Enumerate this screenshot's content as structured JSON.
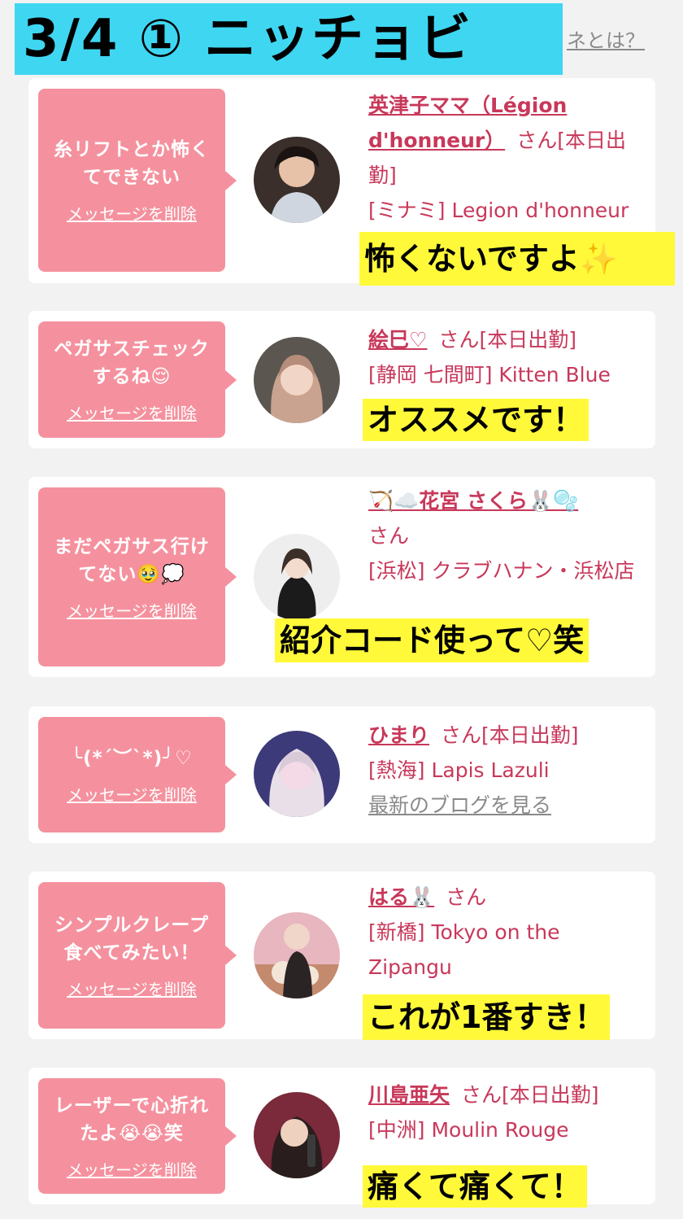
{
  "header": {
    "title": "3/4 ① ニッチョビ",
    "link": "ネとは？"
  },
  "cards": [
    {
      "message": "糸リフトとか怖くてできない",
      "delete": "メッセージを削除",
      "name": "英津子ママ（Légion d'honneur）",
      "san": "さん",
      "status": "[本日出勤]",
      "shop": "[ミナミ] Legion d'honneur",
      "caption": "怖くないですよ✨"
    },
    {
      "message": "ペガサスチェックするね😌",
      "delete": "メッセージを削除",
      "name": "絵巳♡",
      "san": "さん",
      "status": "[本日出勤]",
      "shop": "[静岡 七間町] Kitten Blue",
      "caption": "オススメです！"
    },
    {
      "message": "まだペガサス行けてない🥹💭",
      "delete": "メッセージを削除",
      "name": "🏹☁️花宮 さくら🐰🫧",
      "san": "さん",
      "status": "",
      "shop": "[浜松] クラブハナン・浜松店",
      "caption": "紹介コード使って♡笑"
    },
    {
      "message": "╰(*´︶`*)╯♡",
      "delete": "メッセージを削除",
      "name": "ひまり",
      "san": "さん",
      "status": "[本日出勤]",
      "shop": "[熱海] Lapis Lazuli",
      "blog": "最新のブログを見る",
      "caption": ""
    },
    {
      "message": "シンプルクレープ食べてみたい！",
      "delete": "メッセージを削除",
      "name": "はる🐰",
      "san": "さん",
      "status": "",
      "shop": "[新橋] Tokyo on the Zipangu",
      "caption": "これが1番すき！"
    },
    {
      "message": "レーザーで心折れたよ😭😭笑",
      "delete": "メッセージを削除",
      "name": "川島亜矢",
      "san": "さん",
      "status": "[本日出勤]",
      "shop": "[中洲] Moulin Rouge",
      "caption": "痛くて痛くて！"
    }
  ]
}
